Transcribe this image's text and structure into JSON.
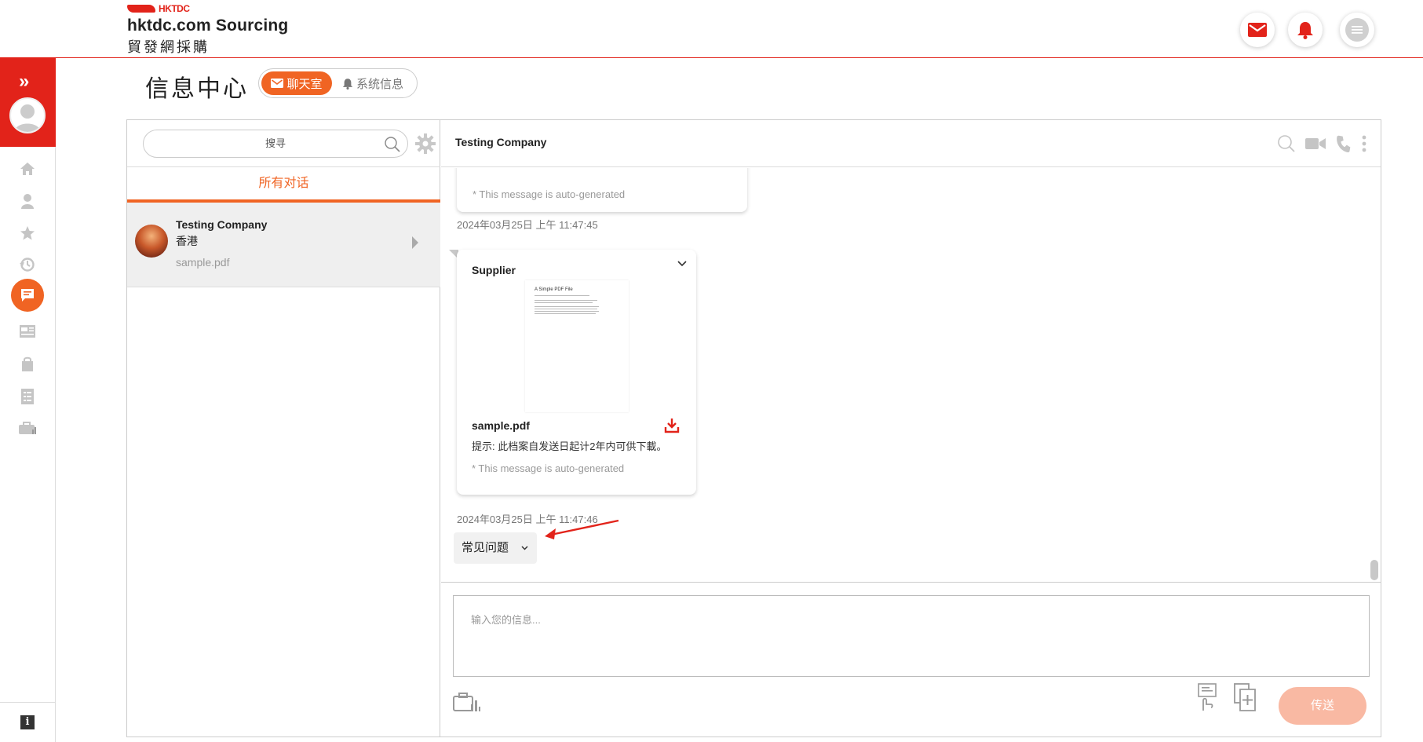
{
  "header": {
    "logo_small": "HKTDC",
    "logo_main": "hktdc.com Sourcing",
    "logo_sub": "貿發網採購",
    "icons": [
      "mail-icon",
      "bell-icon",
      "menu-icon"
    ]
  },
  "rail": {
    "icons": [
      "expand-icon",
      "home-icon",
      "user-icon",
      "star-icon",
      "history-icon",
      "chat-icon",
      "news-icon",
      "shopping-bag-icon",
      "checklist-icon",
      "briefcase-icon",
      "info-icon"
    ],
    "info_label": "i"
  },
  "page": {
    "title": "信息中心",
    "tabs": [
      {
        "label": "聊天室",
        "active": true
      },
      {
        "label": "系统信息",
        "active": false
      }
    ]
  },
  "left": {
    "search_placeholder": "搜寻",
    "filter_tab": "所有对话",
    "conversations": [
      {
        "name": "Testing Company",
        "location": "香港",
        "last_message": "sample.pdf"
      }
    ]
  },
  "chat": {
    "title": "Testing Company",
    "messages": [
      {
        "auto_note": "* This message is auto-generated",
        "timestamp": "2024年03月25日 上午 11:47:45"
      },
      {
        "sender": "Supplier",
        "preview_title": "A Simple PDF File",
        "file_name": "sample.pdf",
        "hint": "提示: 此档案自发送日起计2年内可供下載。",
        "auto_note": "* This message is auto-generated",
        "timestamp": "2024年03月25日 上午 11:47:46"
      }
    ],
    "faq_label": "常见问题",
    "input_placeholder": "输入您的信息...",
    "send_label": "传送"
  },
  "colors": {
    "brand": "#e2231a",
    "accent": "#f06423",
    "send_disabled": "#f9b9a3"
  }
}
